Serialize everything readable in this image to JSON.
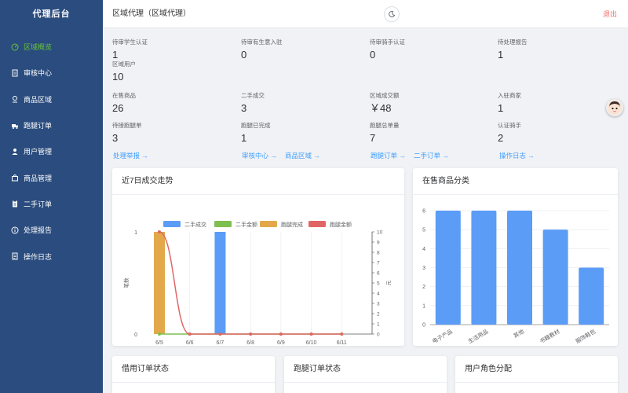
{
  "sidebar": {
    "brand": "代理后台",
    "items": [
      {
        "label": "区域概览",
        "icon": "dashboard-icon",
        "active": true
      },
      {
        "label": "审核中心",
        "icon": "document-icon"
      },
      {
        "label": "商品区域",
        "icon": "location-icon"
      },
      {
        "label": "跑腿订单",
        "icon": "truck-icon"
      },
      {
        "label": "用户管理",
        "icon": "user-icon"
      },
      {
        "label": "商品管理",
        "icon": "shopping-bag-icon"
      },
      {
        "label": "二手订单",
        "icon": "clipboard-icon"
      },
      {
        "label": "处理报告",
        "icon": "info-icon"
      },
      {
        "label": "操作日志",
        "icon": "log-icon"
      }
    ]
  },
  "header": {
    "title": "区域代理（区域代理）",
    "logout": "退出",
    "theme_icon": "moon-icon"
  },
  "stats": [
    {
      "label": "待审学生认证",
      "value": "1"
    },
    {
      "label": "待审有生意入驻",
      "value": "0"
    },
    {
      "label": "待审骑手认证",
      "value": "0"
    },
    {
      "label": "待处理报告",
      "value": "1"
    },
    {
      "label": "区域用户",
      "value": "10"
    },
    {
      "label": "在售商品",
      "value": "26"
    },
    {
      "label": "二手成交",
      "value": "3"
    },
    {
      "label": "区域成交额",
      "value": "￥48"
    },
    {
      "label": "入驻商家",
      "value": "1"
    },
    {
      "label": "待接跑腿单",
      "value": "3"
    },
    {
      "label": "跑腿已完成",
      "value": "1"
    },
    {
      "label": "跑腿总单量",
      "value": "7"
    },
    {
      "label": "认证骑手",
      "value": "2"
    }
  ],
  "links": [
    "处理举报 →",
    "审核中心 →",
    "商品区域 →",
    "跑腿订单 →",
    "二手订单 →",
    "操作日志 →"
  ],
  "cards": {
    "trend": "近7日成交走势",
    "category": "在售商品分类",
    "borrow": "借用订单状态",
    "errand": "跑腿订单状态",
    "roles": "用户角色分配"
  },
  "chart_data": [
    {
      "type": "bar",
      "title": "近7日成交走势",
      "categories": [
        "6/5",
        "6/6",
        "6/7",
        "6/8",
        "6/9",
        "6/10",
        "6/11"
      ],
      "series": [
        {
          "name": "二手成交",
          "kind": "bar",
          "axis": "left",
          "color": "#5b9cf6",
          "values": [
            0,
            0,
            1,
            0,
            0,
            0,
            0
          ]
        },
        {
          "name": "二手金额",
          "kind": "line",
          "axis": "right",
          "color": "#7ec050",
          "values": [
            0,
            0,
            0,
            0,
            0,
            0,
            0
          ]
        },
        {
          "name": "跑腿完成",
          "kind": "bar",
          "axis": "left",
          "color": "#e2a84a",
          "values": [
            1,
            0,
            0,
            0,
            0,
            0,
            0
          ]
        },
        {
          "name": "跑腿金额",
          "kind": "line",
          "axis": "right",
          "color": "#e06666",
          "values": [
            10,
            0,
            0,
            0,
            0,
            0,
            0
          ]
        }
      ],
      "ylabel_left": "笔数",
      "ylabel_right": "元",
      "ylim_left": [
        0,
        1
      ],
      "ylim_right": [
        0,
        10
      ],
      "left_ticks": [
        "0",
        "1"
      ],
      "right_ticks": [
        "0",
        "1",
        "2",
        "3",
        "4",
        "5",
        "6",
        "7",
        "8",
        "9",
        "10"
      ]
    },
    {
      "type": "bar",
      "title": "在售商品分类",
      "categories": [
        "电子产品",
        "生活用品",
        "其他",
        "书籍教材",
        "服饰鞋包"
      ],
      "values": [
        6,
        6,
        6,
        5,
        3
      ],
      "color": "#5b9cf6",
      "ylim": [
        0,
        6
      ],
      "ticks": [
        "0",
        "1",
        "2",
        "3",
        "4",
        "5",
        "6"
      ]
    }
  ]
}
